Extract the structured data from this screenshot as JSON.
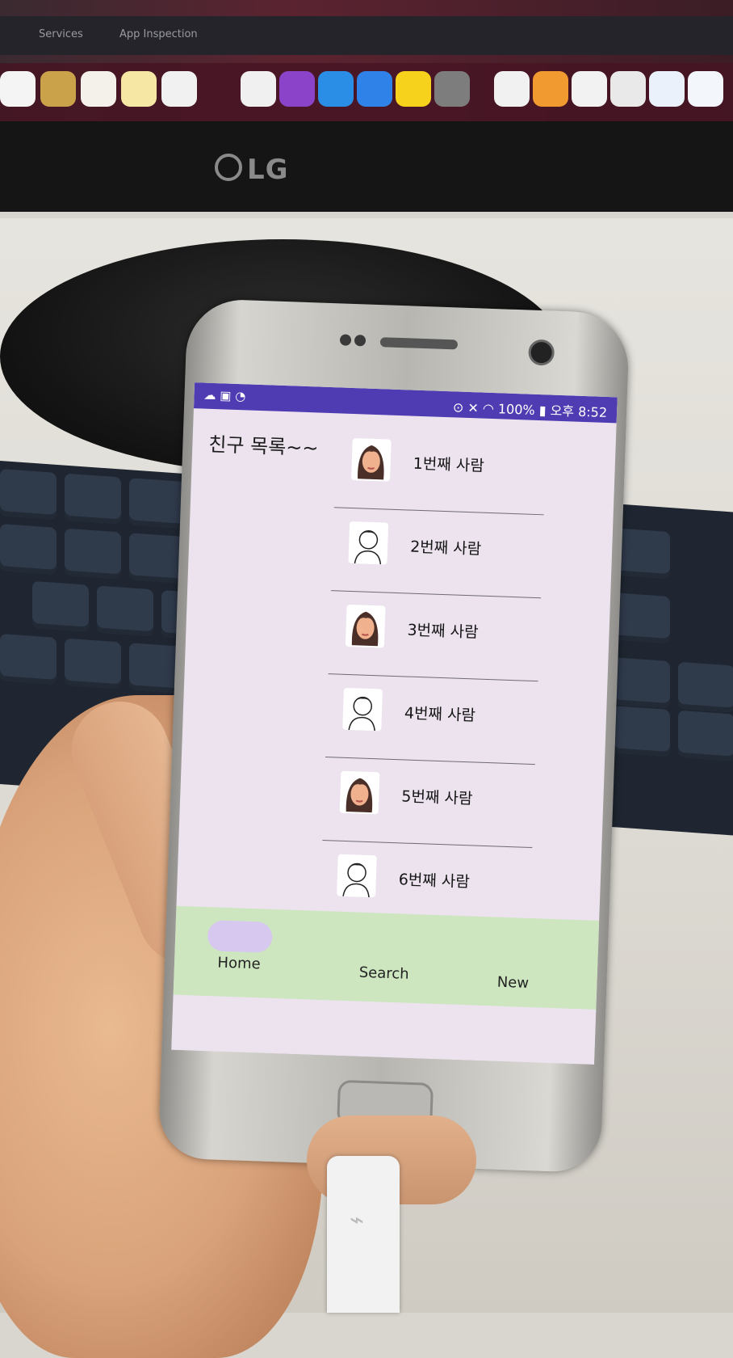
{
  "desktop": {
    "menubar_items": [
      "Services",
      "App Inspection"
    ],
    "monitor_brand": "LG"
  },
  "phone": {
    "status": {
      "right_text": "100%",
      "time_prefix": "오후",
      "time": "8:52"
    },
    "page_title": "친구 목록~~",
    "friends": [
      {
        "label": "1번째 사람",
        "avatar": "woman-avatar-icon"
      },
      {
        "label": "2번째 사람",
        "avatar": "man-avatar-icon"
      },
      {
        "label": "3번째 사람",
        "avatar": "woman-avatar-icon"
      },
      {
        "label": "4번째 사람",
        "avatar": "man-avatar-icon"
      },
      {
        "label": "5번째 사람",
        "avatar": "woman-avatar-icon"
      },
      {
        "label": "6번째 사람",
        "avatar": "man-avatar-icon"
      }
    ],
    "nav": {
      "home": "Home",
      "search": "Search",
      "new": "New",
      "active": "Home"
    },
    "colors": {
      "status_bar": "#4f3bb2",
      "screen_bg": "#ece3ef",
      "nav_bg": "#cde6c0",
      "nav_active_pill": "#d7c8f0"
    }
  }
}
